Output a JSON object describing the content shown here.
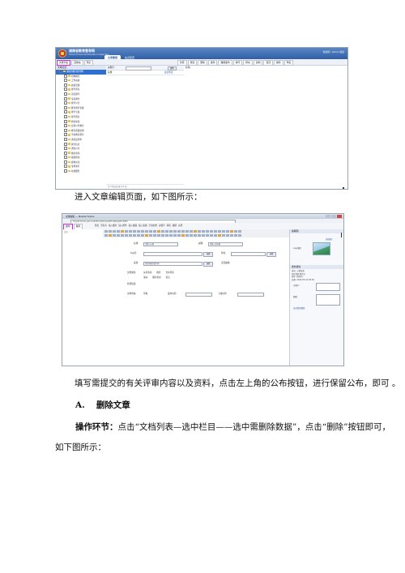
{
  "screenshot1": {
    "portal_name": "湖南省教育督导网",
    "portal_subtitle": "Hunan Provincial Education Inspection",
    "top_tabs": [
      "文章管理",
      "站点配置"
    ],
    "user_info": "欢迎您！admin  退出",
    "toolbar_left": [
      "文章列表",
      "回收站",
      "预览"
    ],
    "toolbar_right": [
      "新增",
      "修改",
      "删除",
      "发布",
      "撤销发布",
      "排序",
      "移动",
      "复制",
      "置顶",
      "推荐",
      "导出"
    ],
    "tree_header": "文章栏目",
    "tree_items": [
      "湖南省教育督导网",
      "机构概况",
      "工作动态",
      "政策法规",
      "督导评估",
      "责任督学",
      "专项督导",
      "督导公告",
      "教育督导专报",
      "督学之窗",
      "督导研究",
      "经验交流",
      "县域义务教育",
      "教育质量监测",
      "学前教育督导",
      "满意度调查",
      "督导信息",
      "通知公告",
      "图片新闻",
      "视频新闻",
      "媒体关注",
      "专题专栏",
      "在线服务"
    ],
    "list_toolbar": "关键字:",
    "list_search_button": "搜索",
    "list_header": "标题",
    "list_header_right": "最近修改",
    "list_footer": "共 0 条记录  第 1/1 页",
    "detail_title": "标题:"
  },
  "caption_1": "进入文章编辑页面，如下图所示：",
  "screenshot2": {
    "window_title": "文章编辑 — Mozilla Firefox",
    "url": "hnjydd.hunan.gov.cn/admin/article/edit?catalogID=1052",
    "ribbon_left": [
      "发布",
      "保存"
    ],
    "ribbon_right": [
      "预览",
      "另存为",
      "插入图片",
      "插入附件",
      "插入视频",
      "插入表格",
      "引用文章",
      "关键字",
      "审核",
      "撤销",
      "关闭"
    ],
    "gutter_label": "正文",
    "form": {
      "title_label": "标题:",
      "title_value": "请输入标题",
      "subtitle_label": "副题:",
      "subtitle_value": "请输入副标题",
      "tag_label": "Tag词:",
      "tag_button": "选择",
      "author_label": "作者:",
      "author_button": "选择",
      "source_label": "来源:",
      "source_value": "湖南省教育督导网",
      "source_button": "选择",
      "editor_label": "责任编辑:",
      "attr_label": "文章属性:",
      "attr_options": [
        "头条新闻",
        "推荐",
        "允许评论",
        "滚动",
        "图片新闻",
        "焦点"
      ],
      "link_label": "外部链接:",
      "publish_label": "发布时间:",
      "expire_label": "下线时间:",
      "status_label": "文章状态:",
      "status_value": "草稿"
    },
    "side": {
      "image_header": "缩略图",
      "image_link": "选择图片",
      "image_caption": "Logo图片",
      "publish_header": "发布属性",
      "publish_items": [
        "发布: 立即发布",
        "同步到其他栏目",
        "排序: 按时间",
        "日期: 2014-05-12 09:36"
      ],
      "keyword_label": "关键字:",
      "summary_label": "摘要:",
      "auto_summary": "自动提取摘要"
    }
  },
  "caption_2": "填写需提交的有关评审内容以及资料，点击左上角的公布按钮，进行保留公布，即可 。",
  "heading_a": {
    "number": "A.",
    "text": "删除文章"
  },
  "steps": {
    "label": "操作环节：",
    "line1": "点击“文档列表—选中栏目——选中需删除数据”，点击“删除”按钮即可，",
    "line2": "如下图所示："
  }
}
